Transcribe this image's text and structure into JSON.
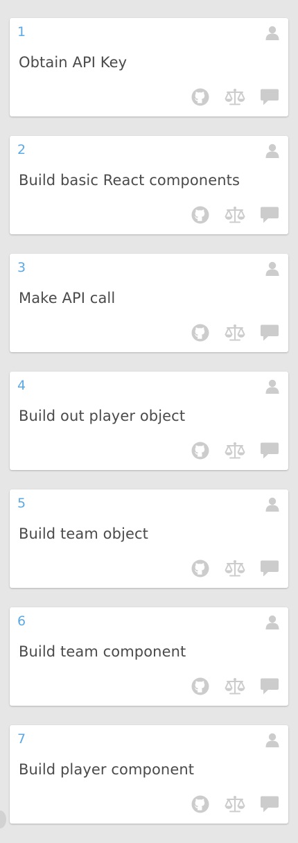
{
  "colors": {
    "background": "#e6e6e6",
    "card": "#ffffff",
    "number": "#5aa9e6",
    "title": "#4a4a4a",
    "icon": "#cccccc"
  },
  "icons": {
    "assignee": "user-icon",
    "actions": [
      "github-icon",
      "scale-icon",
      "comment-icon"
    ]
  },
  "cards": [
    {
      "number": "1",
      "title": "Obtain API Key"
    },
    {
      "number": "2",
      "title": "Build basic React components"
    },
    {
      "number": "3",
      "title": "Make API call"
    },
    {
      "number": "4",
      "title": "Build out player object"
    },
    {
      "number": "5",
      "title": "Build team object"
    },
    {
      "number": "6",
      "title": "Build team component"
    },
    {
      "number": "7",
      "title": "Build player component"
    }
  ]
}
